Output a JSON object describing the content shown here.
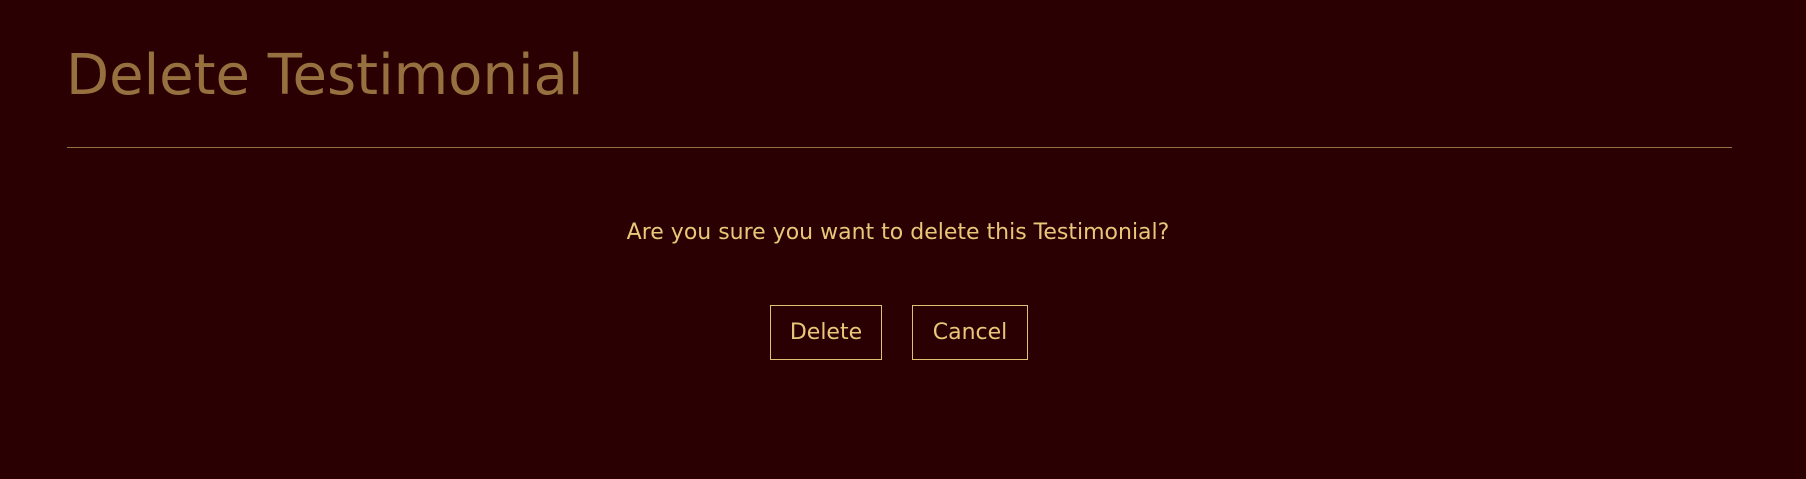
{
  "page": {
    "title": "Delete Testimonial"
  },
  "dialog": {
    "message": "Are you sure you want to delete this Testimonial?",
    "delete_label": "Delete",
    "cancel_label": "Cancel"
  },
  "colors": {
    "background": "#2a0003",
    "title": "#96703e",
    "divider": "#96703e",
    "text_accent": "#e8c778",
    "button_border": "#e2c073"
  }
}
